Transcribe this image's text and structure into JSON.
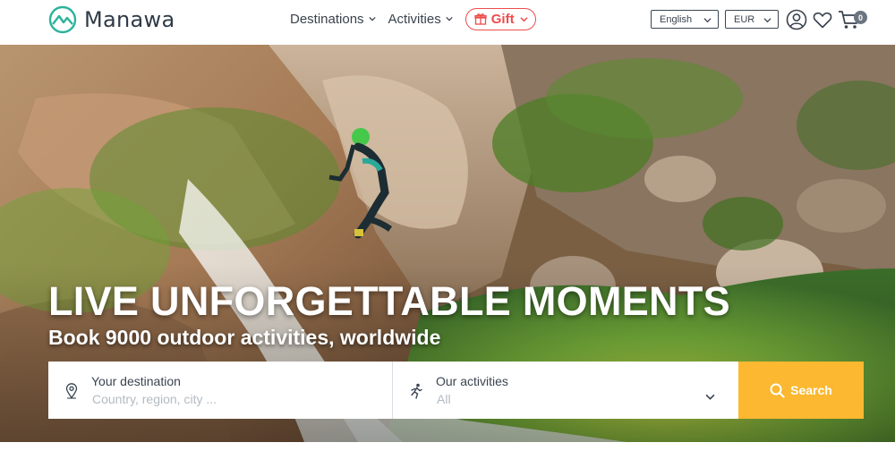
{
  "header": {
    "brand": "Manawa",
    "nav": [
      {
        "label": "Destinations"
      },
      {
        "label": "Activities"
      }
    ],
    "gift_label": "Gift",
    "language": "English",
    "currency": "EUR",
    "cart_count": "0"
  },
  "hero": {
    "headline": "LIVE UNFORGETTABLE MOMENTS",
    "subheadline": "Book 9000 outdoor activities, worldwide"
  },
  "search": {
    "destination_label": "Your destination",
    "destination_placeholder": "Country, region, city ...",
    "activities_label": "Our activities",
    "activities_value": "All",
    "button_label": "Search"
  },
  "colors": {
    "brand_teal": "#2bb39b",
    "gift_red": "#ee4c4c",
    "search_yellow": "#fbb830"
  }
}
